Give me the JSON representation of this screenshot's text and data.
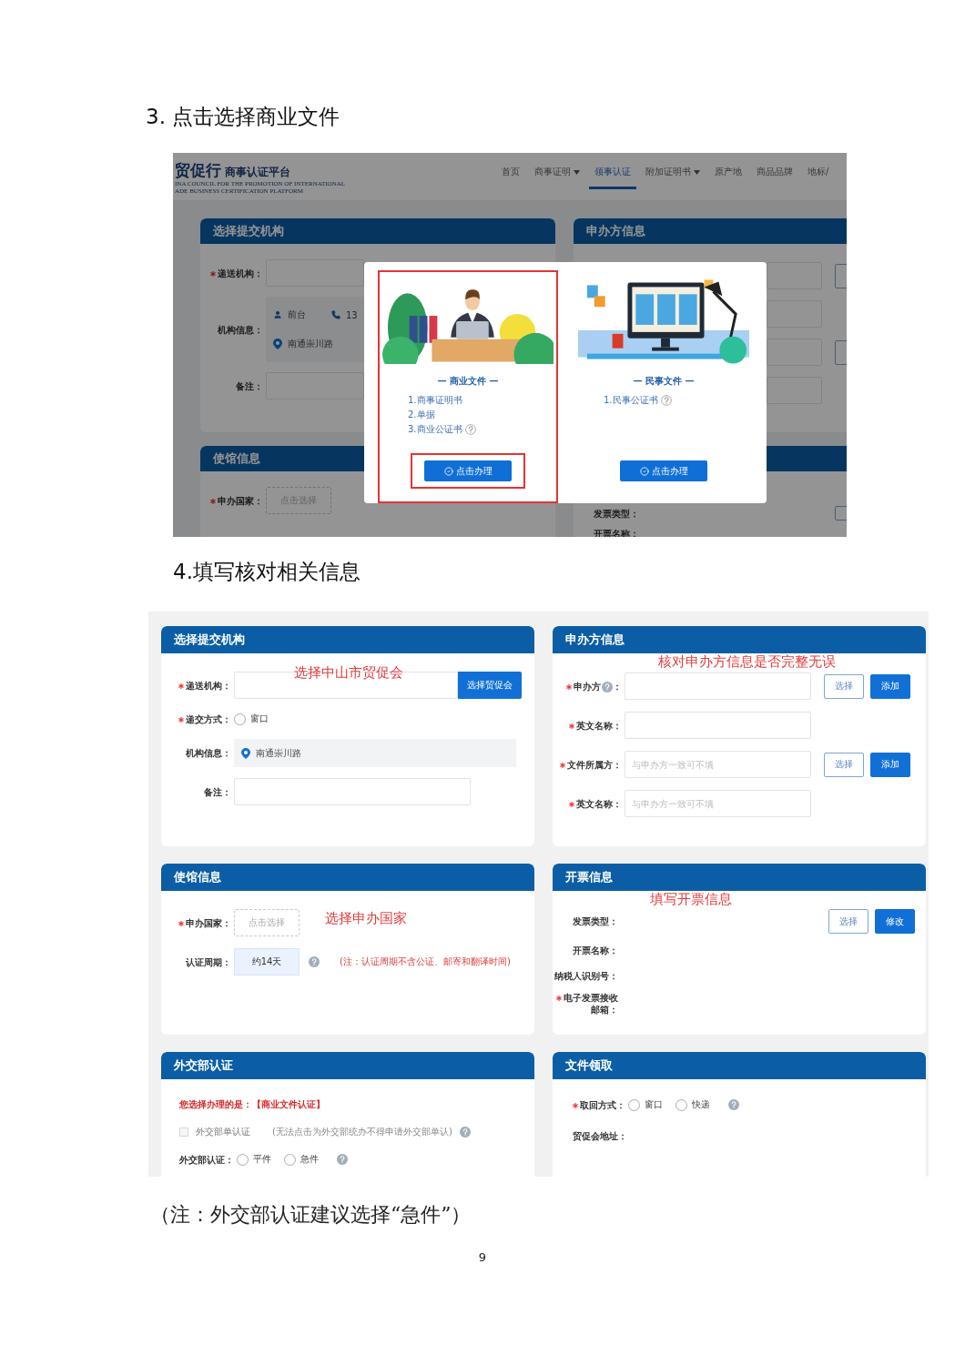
{
  "heading_1": "3. 点击选择商业文件",
  "screenshot_1": {
    "logo": {
      "name": "贸促行",
      "subtitle": "商事认证平台",
      "english": [
        "INA COUNCIL FOR THE PROMOTION OF INTERNATIONAL",
        "ADE BUSINESS CERTIFICATION PLATFORM"
      ]
    },
    "nav": [
      {
        "label": "首页",
        "dropdown": false,
        "selected": false
      },
      {
        "label": "商事证明",
        "dropdown": true,
        "selected": false
      },
      {
        "label": "领事认证",
        "dropdown": false,
        "selected": true
      },
      {
        "label": "附加证明书",
        "dropdown": true,
        "selected": false
      },
      {
        "label": "原产地",
        "dropdown": false,
        "selected": false
      },
      {
        "label": "商品品牌",
        "dropdown": false,
        "selected": false
      },
      {
        "label": "地标/",
        "dropdown": false,
        "selected": false
      }
    ],
    "panels": [
      {
        "title": "选择提交机构",
        "rows": [
          {
            "kind": "input",
            "label": "递送机构：",
            "required": true
          },
          {
            "kind": "info",
            "label": "机构信息：",
            "required": false,
            "lines": [
              [
                {
                  "kind": "contact",
                  "text": "前台"
                },
                {
                  "kind": "phone",
                  "text": "13"
                }
              ],
              [
                {
                  "kind": "address",
                  "text": "南通崇川路"
                }
              ]
            ]
          },
          {
            "kind": "input",
            "label": "备注：",
            "required": false
          }
        ]
      },
      {
        "title": "申办方信息",
        "rows": [
          {
            "kind": "input",
            "button_cut": true
          },
          {
            "kind": "input",
            "button_cut": false
          },
          {
            "kind": "input",
            "button_cut": true
          },
          {
            "kind": "input",
            "button_cut": false
          }
        ]
      },
      {
        "title": "使馆信息",
        "rows": [
          {
            "kind": "picker",
            "label": "申办国家：",
            "required": true,
            "placeholder": "点击选择"
          }
        ]
      },
      {
        "rows": [
          {
            "kind": "label",
            "label": "发票类型：",
            "required": false,
            "button_cut": true
          },
          {
            "kind": "label",
            "label": "开票名称：",
            "required": false
          }
        ]
      }
    ],
    "modal": {
      "cards": [
        {
          "title": "— 商业文件 —",
          "items": [
            {
              "text": "1.商事证明书",
              "help": false
            },
            {
              "text": "2.单据",
              "help": false
            },
            {
              "text": "3.商业公证书",
              "help": true
            }
          ],
          "button": "点击办理",
          "highlighted": true,
          "button_highlighted": true
        },
        {
          "title": "— 民事文件 —",
          "items": [
            {
              "text": "1.民事公证书",
              "help": true
            }
          ],
          "button": "点击办理",
          "highlighted": false,
          "button_highlighted": false
        }
      ]
    }
  },
  "heading_2": "4.填写核对相关信息",
  "screenshot_2": {
    "panels": [
      {
        "title": "选择提交机构",
        "annotation": "选择中山市贸促会",
        "rows": [
          {
            "kind": "input",
            "label": "递送机构：",
            "required": true,
            "attached_button": "选择贸促会"
          },
          {
            "kind": "radio",
            "label": "递交方式：",
            "required": true,
            "options": [
              {
                "label": "窗口",
                "selected": false
              }
            ]
          },
          {
            "kind": "info",
            "label": "机构信息：",
            "required": false,
            "lines": [
              [
                {
                  "kind": "address",
                  "text": "南通崇川路"
                }
              ]
            ]
          },
          {
            "kind": "input",
            "label": "备注：",
            "required": false
          }
        ]
      },
      {
        "title": "申办方信息",
        "annotation": "核对申办方信息是否完整无误",
        "rows": [
          {
            "kind": "input",
            "label": "申办方",
            "label_help": true,
            "label_tail": "：",
            "required": true,
            "buttons": [
              {
                "label": "选择",
                "kind": "outline"
              },
              {
                "label": "添加",
                "kind": "solid"
              }
            ]
          },
          {
            "kind": "input",
            "label": "英文名称：",
            "required": true
          },
          {
            "kind": "input",
            "label": "文件所属方：",
            "required": true,
            "placeholder": "与申办方一致可不填",
            "buttons": [
              {
                "label": "选择",
                "kind": "outline"
              },
              {
                "label": "添加",
                "kind": "solid"
              }
            ]
          },
          {
            "kind": "input",
            "label": "英文名称：",
            "required": true,
            "placeholder": "与申办方一致可不填"
          }
        ]
      },
      {
        "title": "使馆信息",
        "annotation": "选择申办国家",
        "rows": [
          {
            "kind": "picker",
            "label": "申办国家：",
            "required": true,
            "placeholder": "点击选择"
          },
          {
            "kind": "readonly",
            "label": "认证周期：",
            "required": false,
            "value": "约14天",
            "help": true,
            "note": "(注：认证周期不含公证、邮寄和翻译时间)"
          }
        ]
      },
      {
        "title": "开票信息",
        "annotation": "填写开票信息",
        "rows": [
          {
            "kind": "label",
            "label": "发票类型：",
            "required": false,
            "buttons": [
              {
                "label": "选择",
                "kind": "outline"
              },
              {
                "label": "修改",
                "kind": "solid"
              }
            ]
          },
          {
            "kind": "label",
            "label": "开票名称：",
            "required": false
          },
          {
            "kind": "label",
            "label": "纳税人识别号：",
            "required": false
          },
          {
            "kind": "label",
            "label": "电子发票接收邮箱：",
            "required": true
          }
        ]
      },
      {
        "title": "外交部认证",
        "rows": [
          {
            "kind": "notice",
            "text": "您选择办理的是：【商业文件认证】"
          },
          {
            "kind": "checkbox",
            "text": "外交部单认证",
            "checked": false,
            "disabled": true,
            "note": "(无法点击为外交部统办不得申请外交部单认)",
            "help": true
          },
          {
            "kind": "radio",
            "label": "外交部认证：",
            "required": false,
            "options": [
              {
                "label": "平件",
                "selected": false
              },
              {
                "label": "急件",
                "selected": false
              }
            ],
            "help": true
          }
        ]
      },
      {
        "title": "文件领取",
        "rows": [
          {
            "kind": "radio",
            "label": "取回方式：",
            "required": true,
            "options": [
              {
                "label": "窗口",
                "selected": false
              },
              {
                "label": "快递",
                "selected": false
              }
            ],
            "help": true
          },
          {
            "kind": "label",
            "label": "贸促会地址：",
            "required": false
          }
        ]
      }
    ]
  },
  "note": "（注：外交部认证建议选择“急件”）",
  "page_number": "9"
}
